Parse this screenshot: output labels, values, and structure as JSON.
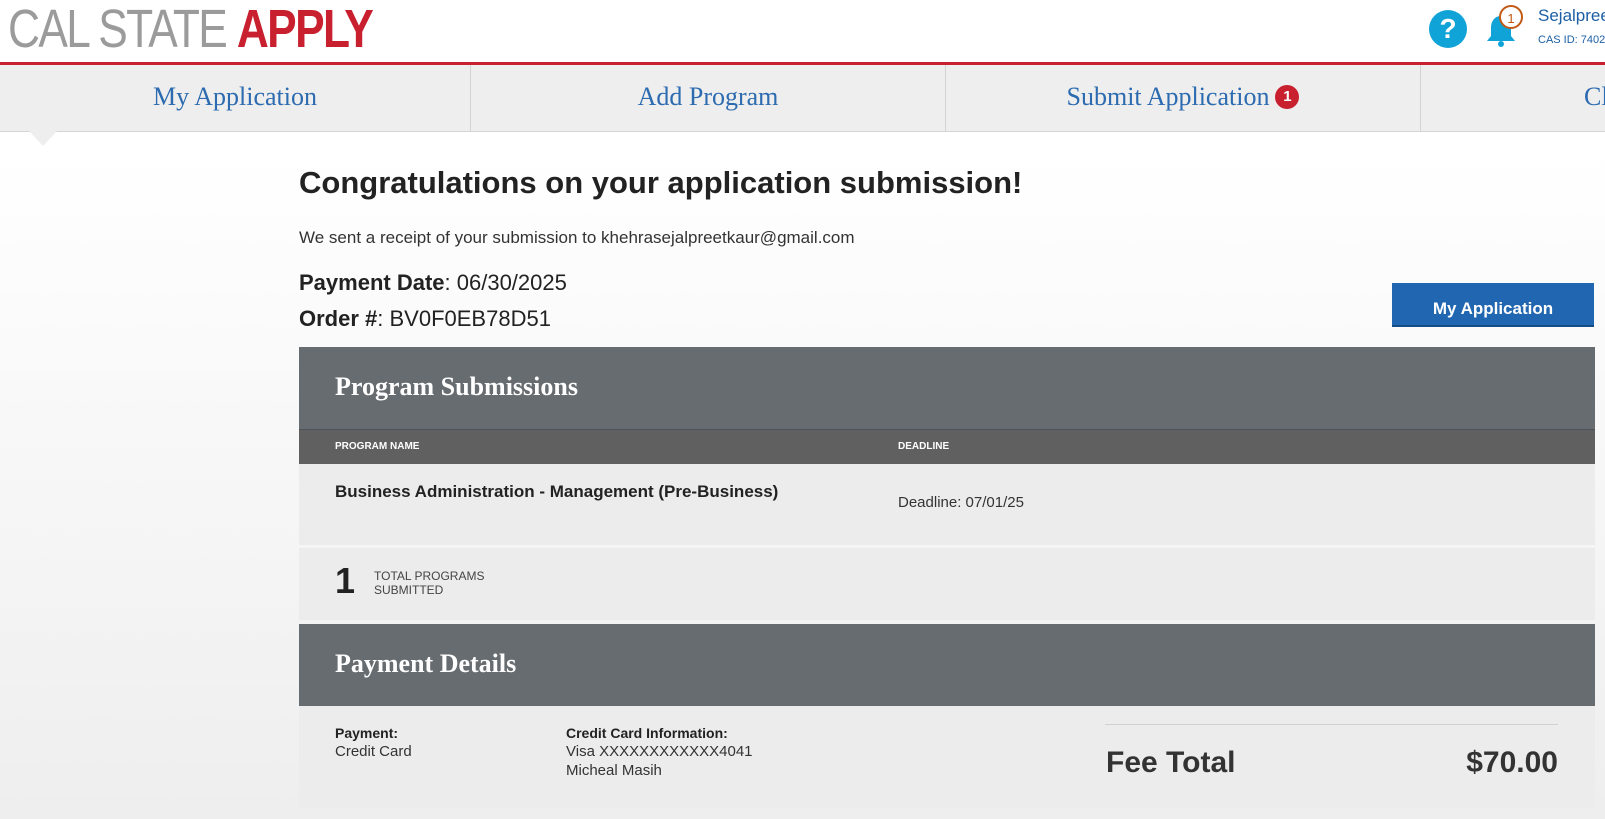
{
  "header": {
    "logo_part1": "CAL STATE ",
    "logo_part2": "APPLY",
    "help_icon_glyph": "?",
    "notification_count": "1",
    "user_name": "Sejalpree",
    "cas_id": "CAS ID: 7402"
  },
  "nav": {
    "tabs": [
      {
        "label": "My Application"
      },
      {
        "label": "Add Program"
      },
      {
        "label": "Submit Application",
        "badge": "1"
      },
      {
        "label": "Cl"
      }
    ]
  },
  "main": {
    "title": "Congratulations on your application submission!",
    "receipt_text": "We sent a receipt of your submission to khehrasejalpreetkaur@gmail.com",
    "payment_date_label": "Payment Date",
    "payment_date": "06/30/2025",
    "order_label": "Order #",
    "order_number": "BV0F0EB78D51",
    "my_application_button": "My Application"
  },
  "program_submissions": {
    "heading": "Program Submissions",
    "columns": [
      "PROGRAM NAME",
      "DEADLINE"
    ],
    "rows": [
      {
        "name": "Business Administration - Management (Pre-Business)",
        "deadline": "Deadline: 07/01/25"
      }
    ],
    "total_count": "1",
    "total_label_line1": "TOTAL PROGRAMS",
    "total_label_line2": "SUBMITTED"
  },
  "payment_details": {
    "heading": "Payment Details",
    "payment_label": "Payment:",
    "payment_method": "Credit Card",
    "card_info_label": "Credit Card Information:",
    "card_number": "Visa XXXXXXXXXXXX4041",
    "card_holder": "Micheal Masih",
    "fee_total_label": "Fee Total",
    "fee_total_amount": "$70.00"
  },
  "colors": {
    "brand_red": "#c8202f",
    "link_blue": "#2c6bb0",
    "section_gray": "#676c70",
    "button_blue": "#2166b0"
  }
}
